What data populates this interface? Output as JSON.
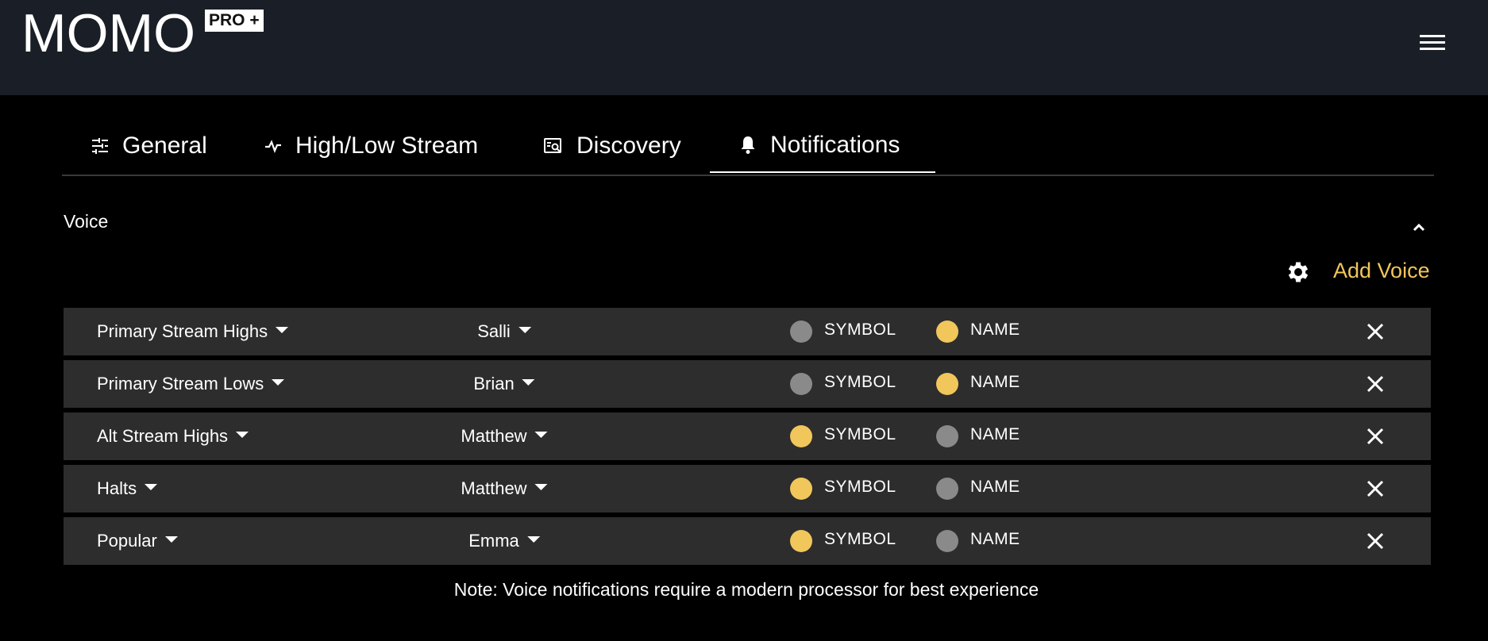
{
  "header": {
    "logo": "MOMO",
    "badge": "PRO +",
    "menu_icon": "hamburger-menu-icon"
  },
  "tabs": [
    {
      "label": "General",
      "icon": "sliders-icon",
      "active": false
    },
    {
      "label": "High/Low Stream",
      "icon": "pulse-icon",
      "active": false
    },
    {
      "label": "Discovery",
      "icon": "discover-icon",
      "active": false
    },
    {
      "label": "Notifications",
      "icon": "bell-icon",
      "active": true
    }
  ],
  "voice_section": {
    "title": "Voice",
    "add_voice_label": "Add Voice",
    "options": {
      "symbol_label": "SYMBOL",
      "name_label": "NAME"
    },
    "rows": [
      {
        "stream": "Primary Stream Highs",
        "voice": "Salli",
        "symbol_on": false,
        "name_on": true
      },
      {
        "stream": "Primary Stream Lows",
        "voice": "Brian",
        "symbol_on": false,
        "name_on": true
      },
      {
        "stream": "Alt Stream Highs",
        "voice": "Matthew",
        "symbol_on": true,
        "name_on": false
      },
      {
        "stream": "Halts",
        "voice": "Matthew",
        "symbol_on": true,
        "name_on": false
      },
      {
        "stream": "Popular",
        "voice": "Emma",
        "symbol_on": true,
        "name_on": false
      }
    ],
    "note": "Note: Voice notifications require a modern processor for best experience"
  },
  "colors": {
    "accent": "#f1c65b",
    "radio_off": "#8a8a8a",
    "row_bg": "#2d2d2d",
    "header_bg": "#1a1e26"
  }
}
